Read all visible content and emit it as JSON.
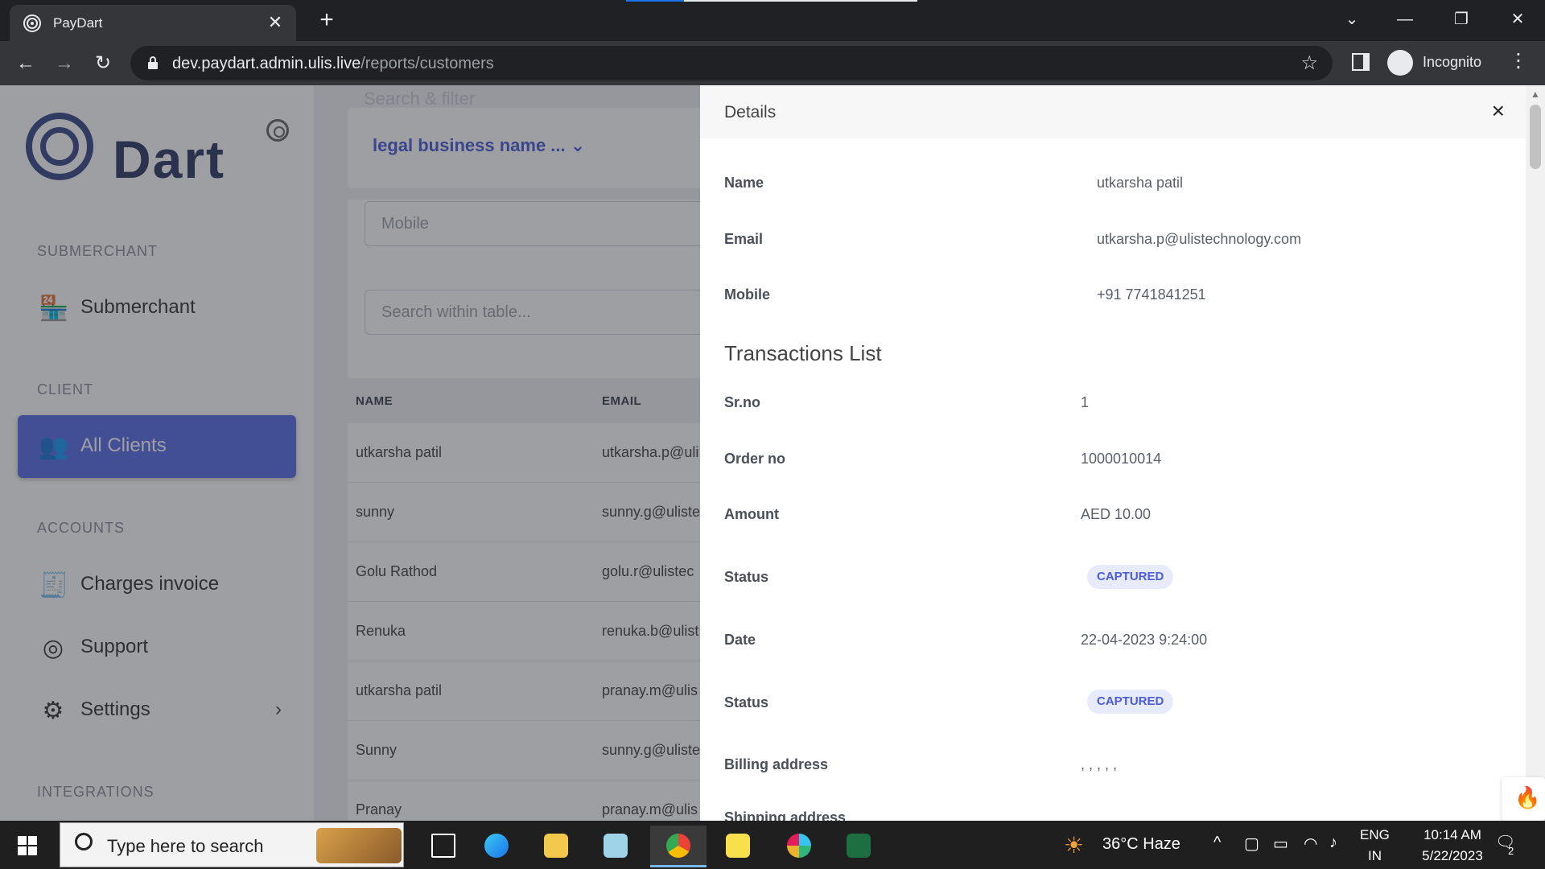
{
  "browser": {
    "tab_title": "PayDart",
    "url_host": "dev.paydart.admin.ulis.live",
    "url_path": "/reports/customers",
    "incognito_label": "Incognito"
  },
  "sidebar": {
    "logo_text": "Dart",
    "sections": {
      "submerchant": "SUBMERCHANT",
      "client": "CLIENT",
      "accounts": "ACCOUNTS",
      "integrations": "INTEGRATIONS"
    },
    "items": {
      "submerchant": "Submerchant",
      "all_clients": "All Clients",
      "charges_invoice": "Charges invoice",
      "support": "Support",
      "settings": "Settings"
    }
  },
  "main": {
    "search_filter_placeholder": "Search & filter",
    "filter_dropdown": "legal business name ...",
    "mobile_placeholder": "Mobile",
    "table_search_placeholder": "Search within table...",
    "columns": [
      "NAME",
      "EMAIL"
    ],
    "rows": [
      {
        "name": "utkarsha patil",
        "email": "utkarsha.p@uli"
      },
      {
        "name": "sunny",
        "email": "sunny.g@uliste"
      },
      {
        "name": "Golu Rathod",
        "email": "golu.r@ulistec"
      },
      {
        "name": "Renuka",
        "email": "renuka.b@ulist"
      },
      {
        "name": "utkarsha patil",
        "email": "pranay.m@ulis"
      },
      {
        "name": "Sunny",
        "email": "sunny.g@uliste"
      },
      {
        "name": "Pranay",
        "email": "pranay.m@ulis"
      }
    ]
  },
  "details": {
    "title": "Details",
    "name_label": "Name",
    "name_value": "utkarsha patil",
    "email_label": "Email",
    "email_value": "utkarsha.p@ulistechnology.com",
    "mobile_label": "Mobile",
    "mobile_value": "+91 7741841251",
    "transactions_title": "Transactions List",
    "srno_label": "Sr.no",
    "srno_value": "1",
    "order_label": "Order no",
    "order_value": "1000010014",
    "amount_label": "Amount",
    "amount_value": "AED 10.00",
    "status_label": "Status",
    "status_value": "CAPTURED",
    "date_label": "Date",
    "date_value": "22-04-2023 9:24:00",
    "status2_label": "Status",
    "status2_value": "CAPTURED",
    "billing_label": "Billing address",
    "billing_value": ", , , , ,",
    "shipping_label": "Shipping address"
  },
  "taskbar": {
    "search_placeholder": "Type here to search",
    "weather": "36°C  Haze",
    "lang_top": "ENG",
    "lang_bottom": "IN",
    "time": "10:14 AM",
    "date": "5/22/2023",
    "notifications": "2"
  }
}
